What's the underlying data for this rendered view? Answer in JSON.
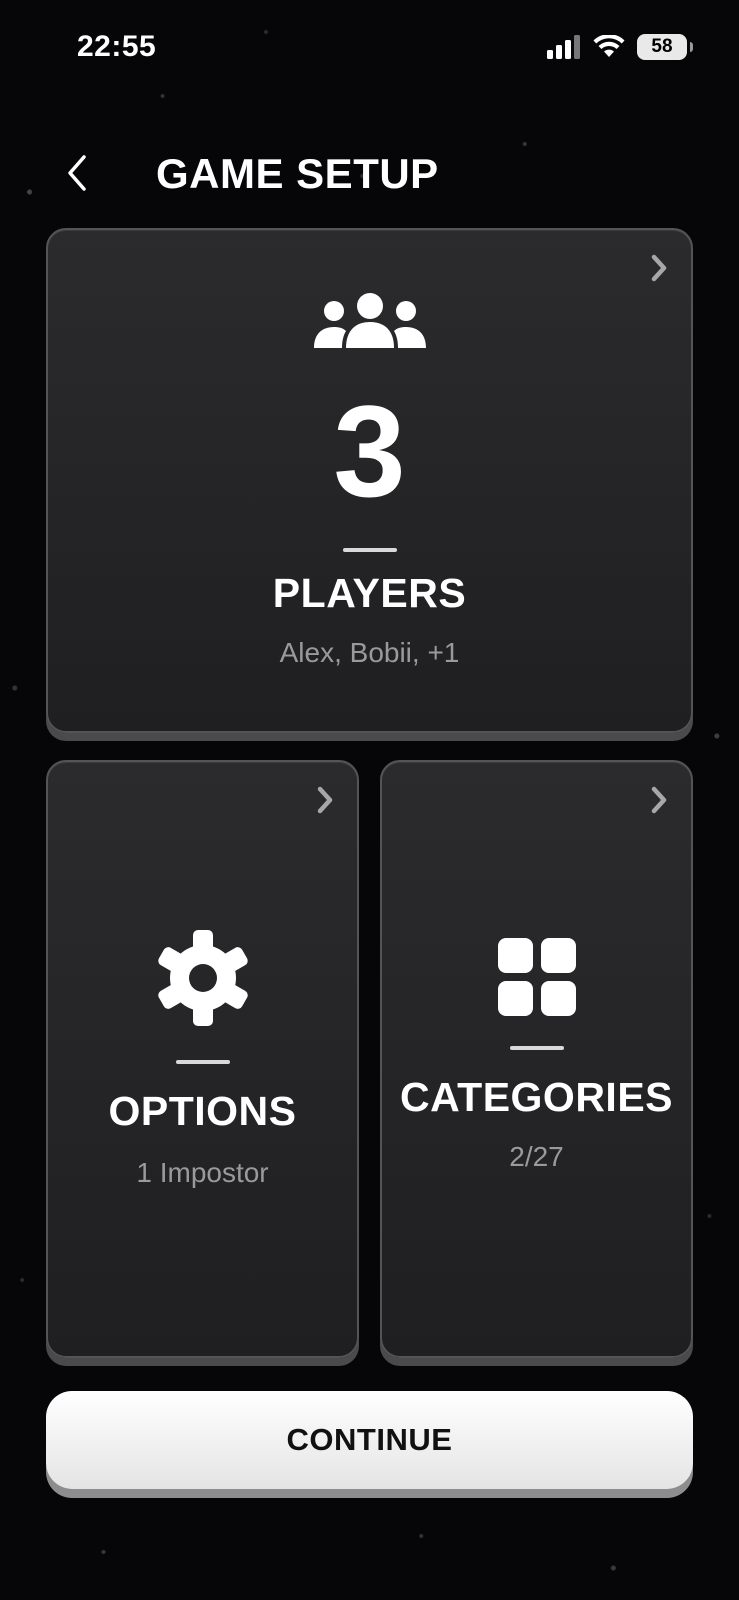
{
  "status_bar": {
    "time": "22:55",
    "battery": "58"
  },
  "header": {
    "title": "GAME SETUP",
    "back_icon": "chevron-left-icon"
  },
  "players_card": {
    "icon": "users-icon",
    "count": "3",
    "title": "PLAYERS",
    "subtitle": "Alex, Bobii, +1"
  },
  "options_card": {
    "icon": "gear-icon",
    "title": "OPTIONS",
    "subtitle": "1 Impostor"
  },
  "categories_card": {
    "icon": "grid-icon",
    "title": "CATEGORIES",
    "subtitle": "2/27"
  },
  "continue_button": {
    "label": "CONTINUE"
  },
  "colors": {
    "background": "#060608",
    "card": "#252527",
    "card_border": "#545456",
    "subtitle": "#9a9a9c",
    "button": "#f4f4f4"
  }
}
